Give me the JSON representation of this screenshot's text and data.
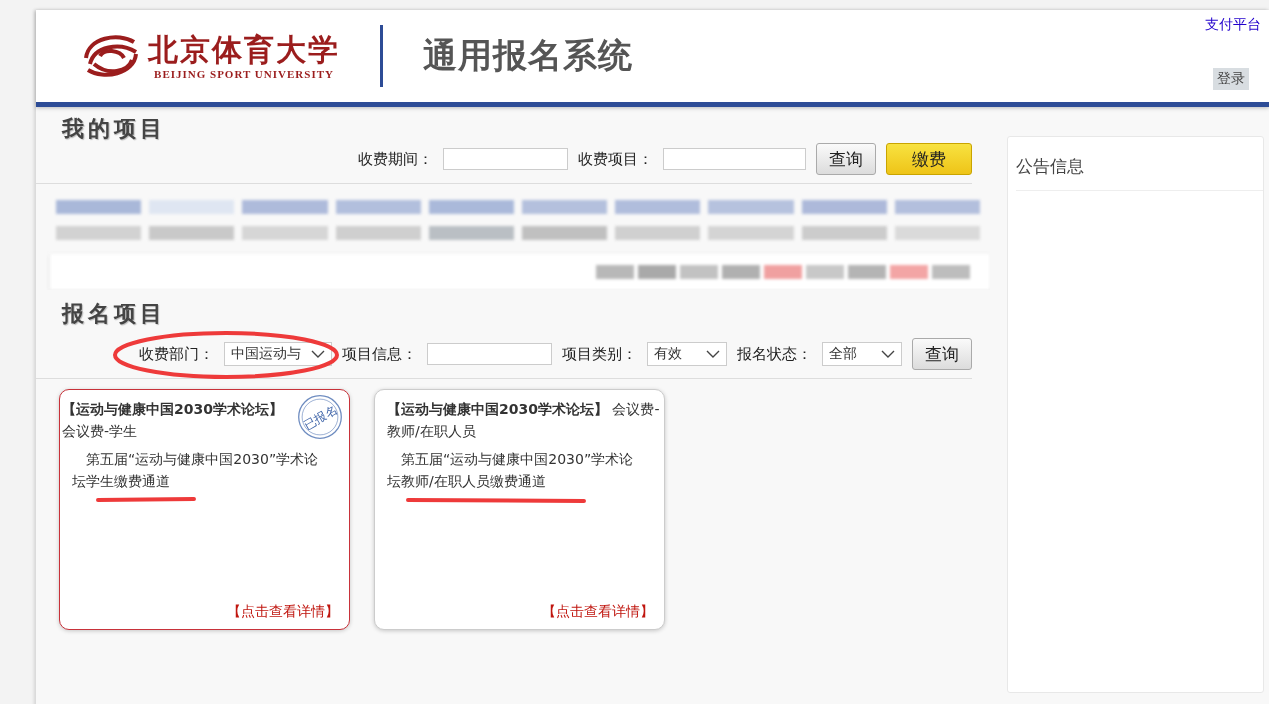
{
  "header": {
    "logo_text": "北京体育大学",
    "logo_subtext": "BEIJING SPORT UNIVERSITY",
    "system_title": "通用报名系统",
    "link": "支付平台",
    "login_button": "登录"
  },
  "my_projects": {
    "title": "我的项目",
    "filters": [
      {
        "label": "收费期间：",
        "kind": "input"
      },
      {
        "label": "收费项目：",
        "kind": "input"
      }
    ],
    "query_button": "查询",
    "pay_button": "缴费",
    "table": {
      "kind": "redacted"
    }
  },
  "registration": {
    "title": "报名项目",
    "filters": [
      {
        "label": "收费部门：",
        "kind": "select",
        "value": "中国运动与"
      },
      {
        "label": "项目信息：",
        "kind": "input"
      },
      {
        "label": "项目类别：",
        "kind": "select",
        "value": "有效"
      },
      {
        "label": "报名状态：",
        "kind": "select",
        "value": "全部"
      }
    ],
    "query_button": "查询",
    "cards": [
      {
        "title": "【运动与健康中国2030学术论坛】",
        "subtitle": "会议费-学生",
        "description": "第五届“运动与健康中国2030”学术论坛学生缴费通道",
        "registered": true,
        "stamp": "已报名",
        "link": "【点击查看详情】"
      },
      {
        "title": "【运动与健康中国2030学术论坛】",
        "subtitle": "会议费-教师/在职人员",
        "description": "第五届“运动与健康中国2030”学术论坛教师/在职人员缴费通道",
        "registered": false,
        "link": "【点击查看详情】"
      }
    ]
  },
  "notice_panel": {
    "title": "公告信息"
  }
}
